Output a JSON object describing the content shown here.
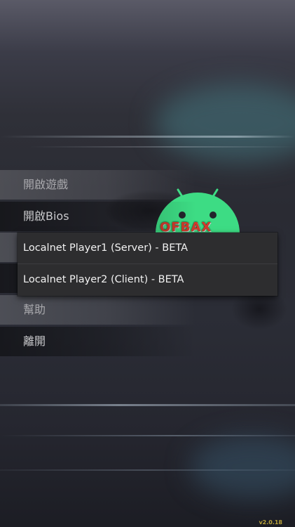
{
  "menu": {
    "items": [
      {
        "label": "開啟遊戲"
      },
      {
        "label": "開啟Bios"
      },
      {
        "label": ""
      },
      {
        "label": ""
      },
      {
        "label": "幫助"
      },
      {
        "label": "離開"
      }
    ]
  },
  "popup": {
    "options": [
      {
        "label": "Localnet Player1 (Server) - BETA"
      },
      {
        "label": "Localnet Player2 (Client) - BETA"
      }
    ]
  },
  "logo": {
    "text": "OFBAX",
    "icon": "android-robot-icon"
  },
  "footer": {
    "version": "v2.0.18"
  },
  "colors": {
    "popup_bg": "#2d2d2f",
    "popup_text": "#f2f2f2",
    "menu_text": "#a8a8ac",
    "android_green": "#3ddc84",
    "version_text": "#b9a23a"
  }
}
